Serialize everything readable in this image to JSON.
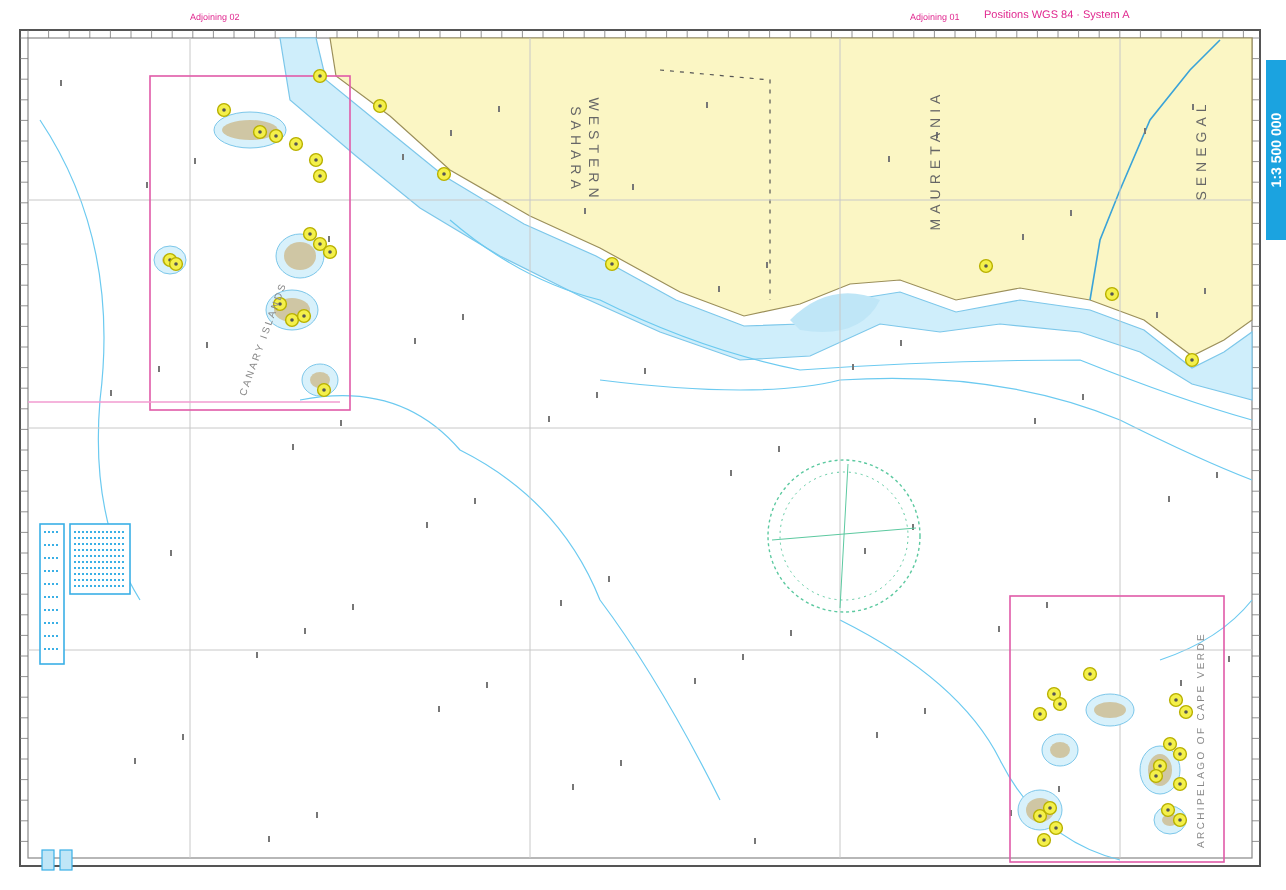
{
  "header": {
    "adjoining_left": "Adjoining 02",
    "adjoining_right": "Adjoining 01",
    "positions": "Positions WGS 84 · System A"
  },
  "scale": "1:3 500 000",
  "region_labels": [
    {
      "kind": "country",
      "lines": [
        "WESTERN",
        "SAHARA"
      ]
    },
    {
      "kind": "country",
      "lines": [
        "MAURETANIA"
      ]
    },
    {
      "kind": "country",
      "lines": [
        "SENEGAL"
      ]
    },
    {
      "kind": "islands",
      "lines": [
        "CANARY  ISLANDS"
      ]
    },
    {
      "kind": "islands",
      "lines": [
        "ARCHIPELAGO OF CAPE VERDE"
      ]
    }
  ]
}
